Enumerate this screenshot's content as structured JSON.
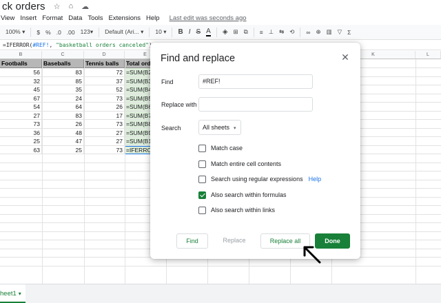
{
  "title": {
    "doc_name": "ck orders",
    "star_icon": "☆",
    "folder_icon": "⌂",
    "cloud_icon": "☁"
  },
  "menu": {
    "items": [
      "View",
      "Insert",
      "Format",
      "Data",
      "Tools",
      "Extensions",
      "Help"
    ],
    "last_edit": "Last edit was seconds ago"
  },
  "toolbar": {
    "zoom": "100%",
    "zoom_caret": "▾",
    "currency": "$",
    "percent": "%",
    "dec_less": ".0",
    "dec_more": ".00",
    "more_formats": "123",
    "more_formats_caret": "▾",
    "font": "Default (Ari...",
    "font_caret": "▾",
    "size": "10",
    "size_caret": "▾",
    "bold": "B",
    "italic": "I",
    "strike": "S",
    "text_color": "A",
    "fill": "◈",
    "borders": "⊞",
    "merge": "⧉",
    "align": "≡",
    "valign": "⊥",
    "wrap": "⇆",
    "rotate": "⟲",
    "link": "∞",
    "comment": "⊕",
    "chart": "▥",
    "filter": "▽",
    "functions": "Σ"
  },
  "formula": {
    "prefix": "=IFERROR(",
    "ref": "#REF!",
    "mid": ", ",
    "str": "\"basketball orders canceled\"",
    "suffix": ")"
  },
  "grid": {
    "columns": [
      "B",
      "C",
      "D",
      "E",
      "",
      "",
      "",
      "",
      "K",
      "L"
    ],
    "headers": [
      "Footballs",
      "Baseballs",
      "Tennis balls",
      "Total orde"
    ],
    "rows": [
      [
        "56",
        "83",
        "72",
        "=SUM(B2"
      ],
      [
        "32",
        "85",
        "37",
        "=SUM(B3"
      ],
      [
        "45",
        "35",
        "52",
        "=SUM(B4"
      ],
      [
        "67",
        "24",
        "73",
        "=SUM(B5"
      ],
      [
        "54",
        "64",
        "26",
        "=SUM(B6"
      ],
      [
        "27",
        "83",
        "17",
        "=SUM(B7"
      ],
      [
        "73",
        "26",
        "73",
        "=SUM(B8"
      ],
      [
        "36",
        "48",
        "27",
        "=SUM(B9"
      ],
      [
        "25",
        "47",
        "27",
        "=SUM(B1"
      ],
      [
        "63",
        "25",
        "73",
        "=IFERRO"
      ]
    ]
  },
  "sheet_tab": {
    "label": "heet1",
    "caret": "▾"
  },
  "dialog": {
    "title": "Find and replace",
    "close_icon": "✕",
    "find_label": "Find",
    "find_value": "#REF!",
    "replace_label": "Replace with",
    "replace_value": "",
    "search_label": "Search",
    "search_value": "All sheets",
    "search_caret": "▾",
    "options": [
      {
        "label": "Match case",
        "checked": false
      },
      {
        "label": "Match entire cell contents",
        "checked": false
      },
      {
        "label": "Search using regular expressions",
        "checked": false
      },
      {
        "label": "Also search within formulas",
        "checked": true
      },
      {
        "label": "Also search within links",
        "checked": false
      }
    ],
    "help_link": "Help",
    "buttons": {
      "find": "Find",
      "replace": "Replace",
      "replace_all": "Replace all",
      "done": "Done"
    }
  },
  "colors": {
    "accent_green": "#188038",
    "link_blue": "#1a73e8",
    "header_gray": "#b7b7b7",
    "formula_cell": "#ddeedb"
  }
}
